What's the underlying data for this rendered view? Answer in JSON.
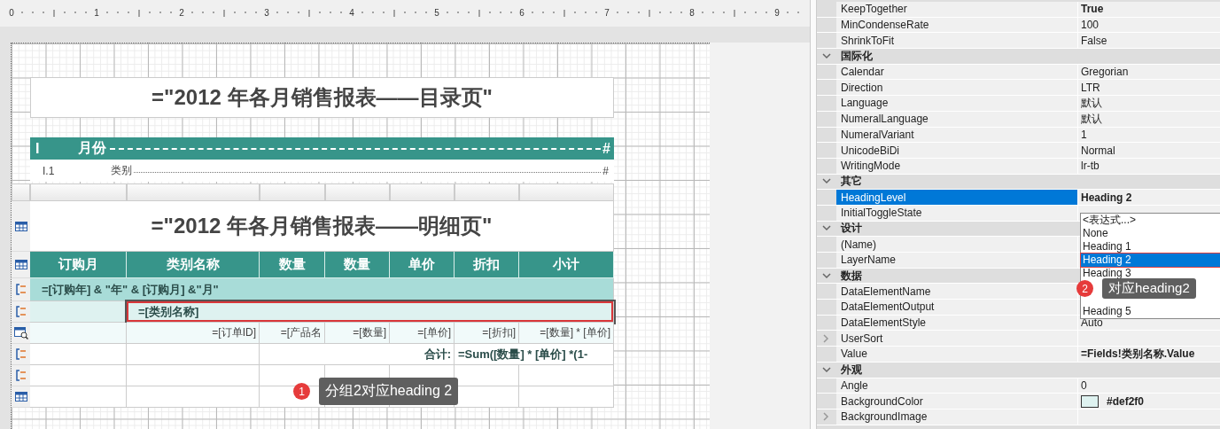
{
  "ruler": {
    "labels": [
      "0",
      "1",
      "2",
      "3",
      "4",
      "5",
      "6",
      "7",
      "8",
      "9"
    ]
  },
  "toc": {
    "title": "=\"2012 年各月销售报表——目录页\"",
    "header": {
      "number": "I",
      "label": "月份",
      "page": "#"
    },
    "rows": [
      {
        "number": "I.1",
        "label": "类别",
        "page": "#"
      }
    ]
  },
  "table": {
    "title": "=\"2012 年各月销售报表——明细页\"",
    "columns": [
      "订购月",
      "类别名称",
      "数量",
      "数量",
      "单价",
      "折扣",
      "小计"
    ],
    "group1": "=[订购年] & \"年\"  & [订购月]  &\"月\"",
    "group2": {
      "text": "=[类别名称]",
      "selected": true
    },
    "detail": [
      "=[订单ID]",
      "=[产品名",
      "=[数量]",
      "=[单价]",
      "=[折扣]",
      "=[数量] * [单价]"
    ],
    "total_label": "合计:",
    "total_value": "=Sum([数量] * [单价] *(1-"
  },
  "properties": [
    {
      "kind": "property",
      "name": "KeepTogether",
      "value": "True",
      "bold": true,
      "selected": false
    },
    {
      "kind": "property",
      "name": "MinCondenseRate",
      "value": "100",
      "bold": false,
      "selected": false
    },
    {
      "kind": "property",
      "name": "ShrinkToFit",
      "value": "False",
      "bold": false,
      "selected": false
    },
    {
      "kind": "category",
      "name": "国际化",
      "expanded": true
    },
    {
      "kind": "property",
      "name": "Calendar",
      "value": "Gregorian",
      "bold": false,
      "selected": false
    },
    {
      "kind": "property",
      "name": "Direction",
      "value": "LTR",
      "bold": false,
      "selected": false
    },
    {
      "kind": "property",
      "name": "Language",
      "value": "默认",
      "bold": false,
      "selected": false
    },
    {
      "kind": "property",
      "name": "NumeralLanguage",
      "value": "默认",
      "bold": false,
      "selected": false
    },
    {
      "kind": "property",
      "name": "NumeralVariant",
      "value": "1",
      "bold": false,
      "selected": false
    },
    {
      "kind": "property",
      "name": "UnicodeBiDi",
      "value": "Normal",
      "bold": false,
      "selected": false
    },
    {
      "kind": "property",
      "name": "WritingMode",
      "value": "lr-tb",
      "bold": false,
      "selected": false
    },
    {
      "kind": "category",
      "name": "其它",
      "expanded": true
    },
    {
      "kind": "property",
      "name": "HeadingLevel",
      "value": "Heading 2",
      "bold": true,
      "selected": true
    },
    {
      "kind": "property",
      "name": "InitialToggleState",
      "selected": false
    },
    {
      "kind": "category",
      "name": "设计",
      "expanded": true
    },
    {
      "kind": "property",
      "name": "(Name)",
      "selected": false
    },
    {
      "kind": "property",
      "name": "LayerName",
      "selected": false
    },
    {
      "kind": "category",
      "name": "数据",
      "expanded": true
    },
    {
      "kind": "property",
      "name": "DataElementName",
      "selected": false
    },
    {
      "kind": "property",
      "name": "DataElementOutput",
      "selected": false
    },
    {
      "kind": "property",
      "name": "DataElementStyle",
      "value": "Auto",
      "bold": false,
      "selected": false
    },
    {
      "kind": "group",
      "name": "UserSort",
      "expanded": false,
      "selected": false
    },
    {
      "kind": "property",
      "name": "Value",
      "value": "=Fields!类别名称.Value",
      "bold": true,
      "selected": false
    },
    {
      "kind": "category",
      "name": "外观",
      "expanded": true
    },
    {
      "kind": "property",
      "name": "Angle",
      "value": "0",
      "bold": false,
      "selected": false
    },
    {
      "kind": "color",
      "name": "BackgroundColor",
      "value": "#def2f0",
      "bold": true,
      "selected": false
    },
    {
      "kind": "group",
      "name": "BackgroundImage",
      "expanded": false,
      "selected": false
    }
  ],
  "dropdown": {
    "items": [
      {
        "label": "<表达式...>",
        "selected": false
      },
      {
        "label": "None",
        "selected": false
      },
      {
        "label": "Heading 1",
        "selected": false
      },
      {
        "label": "Heading 2",
        "selected": true
      },
      {
        "label": "Heading 3",
        "selected": false
      },
      {
        "label": "Heading 5",
        "selected": false
      }
    ]
  },
  "callouts": [
    {
      "number": "1",
      "text": "分组2对应heading 2"
    },
    {
      "number": "2",
      "text": "对应heading2"
    }
  ]
}
